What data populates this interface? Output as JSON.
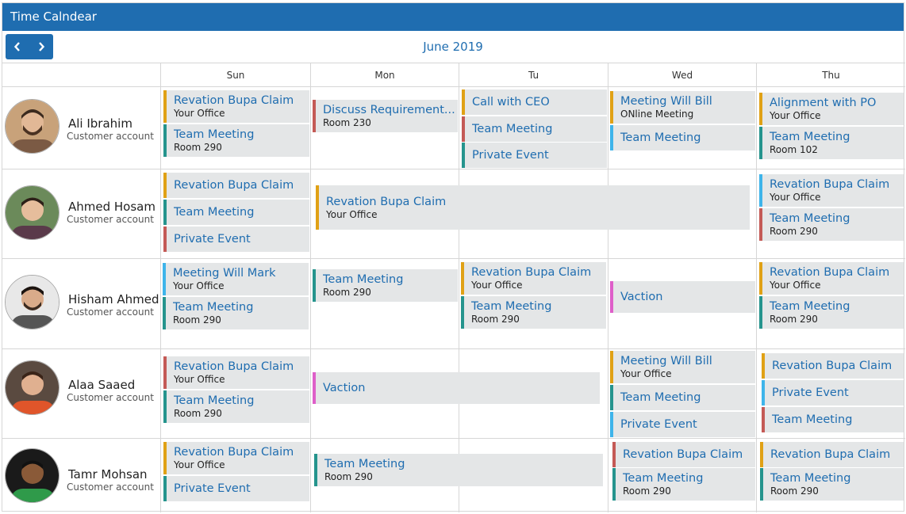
{
  "app": {
    "title": "Time Calndear"
  },
  "toolbar": {
    "month_label": "June 2019",
    "prev_icon": "chevron-left-icon",
    "next_icon": "chevron-right-icon"
  },
  "days": [
    "Sun",
    "Mon",
    "Tu",
    "Wed",
    "Thu"
  ],
  "colors": {
    "header": "#1f6db0",
    "orange": "#e0a115",
    "teal": "#25948d",
    "red": "#c45a56",
    "blue": "#3eb4ea",
    "pink": "#de5fc9",
    "event_bg": "#e4e6e7"
  },
  "people": [
    {
      "name": "Ali Ibrahim",
      "role": "Customer account"
    },
    {
      "name": "Ahmed Hosam",
      "role": "Customer account"
    },
    {
      "name": "Hisham Ahmed",
      "role": "Customer account"
    },
    {
      "name": "Alaa Saaed",
      "role": "Customer account"
    },
    {
      "name": "Tamr Mohsan",
      "role": "Customer account"
    }
  ],
  "events": [
    {
      "title": "Revation Bupa Claim",
      "subtitle": "Your Office",
      "color": "orange"
    },
    {
      "title": "Team Meeting",
      "subtitle": "Room 290",
      "color": "teal"
    },
    {
      "title": "Discuss Requirement...",
      "subtitle": "Room 230",
      "color": "red"
    },
    {
      "title": "Call with CEO",
      "subtitle": "",
      "color": "orange"
    },
    {
      "title": "Team Meeting",
      "subtitle": "",
      "color": "red"
    },
    {
      "title": "Private Event",
      "subtitle": "",
      "color": "teal"
    },
    {
      "title": "Meeting Will Bill",
      "subtitle": "ONline Meeting",
      "color": "orange"
    },
    {
      "title": "Team Meeting",
      "subtitle": "",
      "color": "blue"
    },
    {
      "title": "Alignment with PO",
      "subtitle": "Your Office",
      "color": "orange"
    },
    {
      "title": "Team Meeting",
      "subtitle": "Room 102",
      "color": "teal"
    },
    {
      "title": "Revation Bupa Claim",
      "subtitle": "",
      "color": "orange"
    },
    {
      "title": "Team Meeting",
      "subtitle": "",
      "color": "teal"
    },
    {
      "title": "Private Event",
      "subtitle": "",
      "color": "red"
    },
    {
      "title": "Revation Bupa Claim",
      "subtitle": "Your Office",
      "color": "orange"
    },
    {
      "title": "Revation Bupa Claim",
      "subtitle": "Your Office",
      "color": "blue"
    },
    {
      "title": "Team Meeting",
      "subtitle": "Room 290",
      "color": "red"
    },
    {
      "title": "Meeting Will Mark",
      "subtitle": "Your Office",
      "color": "blue"
    },
    {
      "title": "Team Meeting",
      "subtitle": "Room 290",
      "color": "teal"
    },
    {
      "title": "Team Meeting",
      "subtitle": "Room 290",
      "color": "teal"
    },
    {
      "title": "Revation Bupa Claim",
      "subtitle": "Your Office",
      "color": "orange"
    },
    {
      "title": "Team Meeting",
      "subtitle": "Room 290",
      "color": "teal"
    },
    {
      "title": "Vaction",
      "subtitle": "",
      "color": "pink"
    },
    {
      "title": "Revation Bupa Claim",
      "subtitle": "Your Office",
      "color": "orange"
    },
    {
      "title": "Team Meeting",
      "subtitle": "Room 290",
      "color": "teal"
    },
    {
      "title": "Revation Bupa Claim",
      "subtitle": "Your Office",
      "color": "red"
    },
    {
      "title": "Team Meeting",
      "subtitle": "Room 290",
      "color": "teal"
    },
    {
      "title": "Vaction",
      "subtitle": "",
      "color": "pink"
    },
    {
      "title": "Meeting Will Bill",
      "subtitle": "Your Office",
      "color": "orange"
    },
    {
      "title": "Team Meeting",
      "subtitle": "",
      "color": "teal"
    },
    {
      "title": "Private Event",
      "subtitle": "",
      "color": "blue"
    },
    {
      "title": "Revation Bupa Claim",
      "subtitle": "",
      "color": "orange"
    },
    {
      "title": "Private Event",
      "subtitle": "",
      "color": "blue"
    },
    {
      "title": "Team Meeting",
      "subtitle": "",
      "color": "red"
    },
    {
      "title": "Revation Bupa Claim",
      "subtitle": "Your Office",
      "color": "orange"
    },
    {
      "title": "Private Event",
      "subtitle": "",
      "color": "teal"
    },
    {
      "title": "Team Meeting",
      "subtitle": "Room 290",
      "color": "teal"
    },
    {
      "title": "Revation Bupa Claim",
      "subtitle": "",
      "color": "red"
    },
    {
      "title": "Team Meeting",
      "subtitle": "Room 290",
      "color": "teal"
    },
    {
      "title": "Revation Bupa Claim",
      "subtitle": "",
      "color": "orange"
    },
    {
      "title": "Team Meeting",
      "subtitle": "Room 290",
      "color": "teal"
    }
  ]
}
